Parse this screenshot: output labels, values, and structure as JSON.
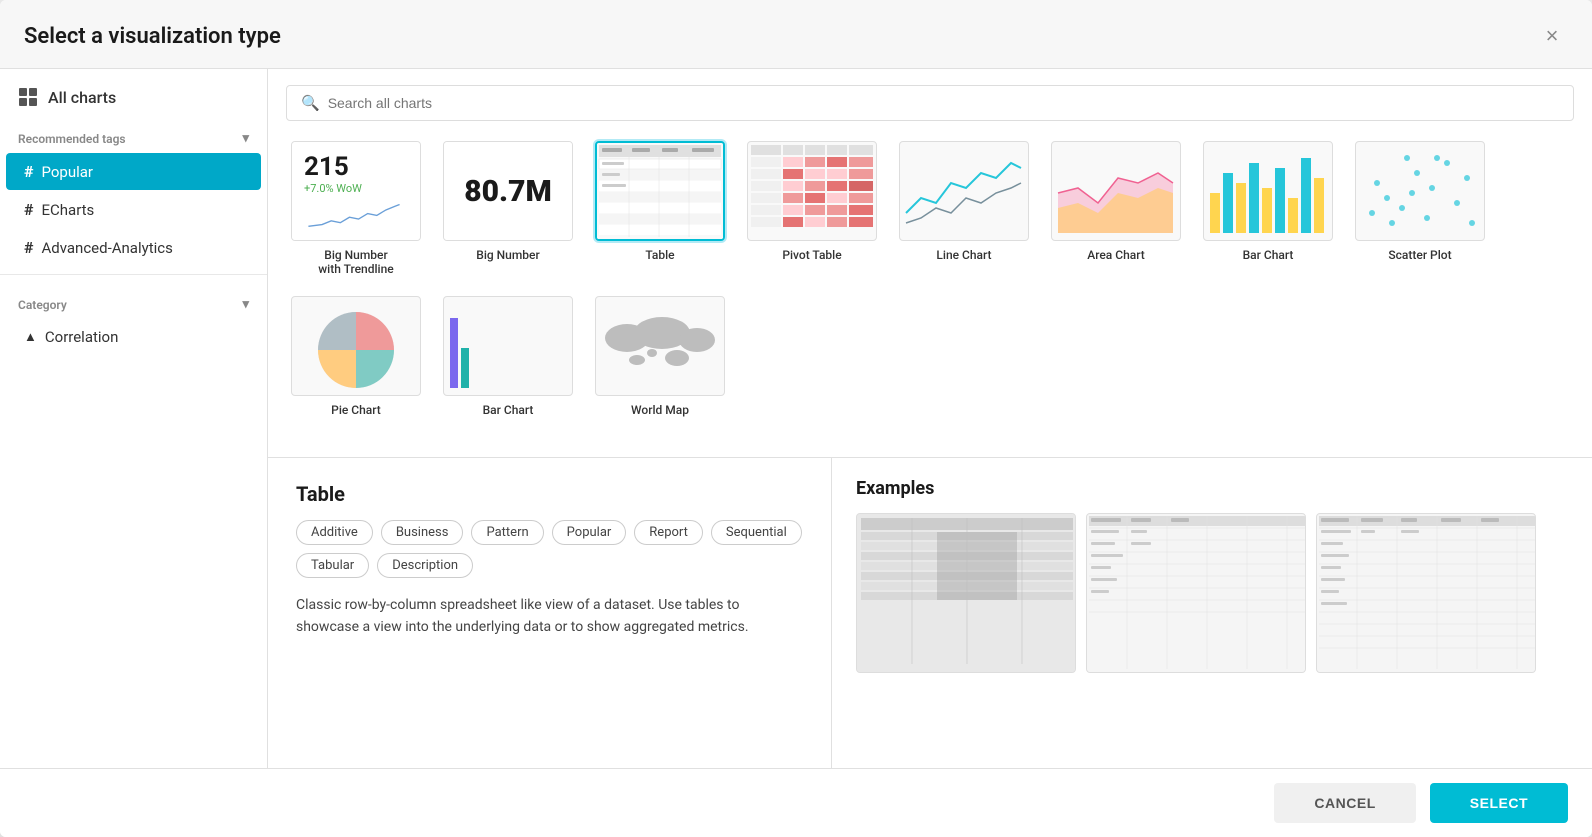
{
  "dialog": {
    "title": "Select a visualization type",
    "close_label": "×"
  },
  "sidebar": {
    "all_charts_label": "All charts",
    "recommended_tags_label": "Recommended tags",
    "category_label": "Category",
    "tags": [
      {
        "id": "popular",
        "label": "Popular",
        "active": true
      },
      {
        "id": "echarts",
        "label": "ECharts",
        "active": false
      },
      {
        "id": "advanced-analytics",
        "label": "Advanced-Analytics",
        "active": false
      }
    ],
    "categories": [
      {
        "id": "correlation",
        "label": "Correlation",
        "active": false
      }
    ]
  },
  "search": {
    "placeholder": "Search all charts"
  },
  "charts": [
    {
      "id": "big-number-trendline",
      "label": "Big Number\nwith Trendline",
      "selected": false
    },
    {
      "id": "big-number",
      "label": "Big Number",
      "selected": false
    },
    {
      "id": "table",
      "label": "Table",
      "selected": true
    },
    {
      "id": "pivot-table",
      "label": "Pivot Table",
      "selected": false
    },
    {
      "id": "line-chart",
      "label": "Line Chart",
      "selected": false
    },
    {
      "id": "area-chart",
      "label": "Area Chart",
      "selected": false
    },
    {
      "id": "bar-chart",
      "label": "Bar Chart",
      "selected": false
    },
    {
      "id": "scatter-plot",
      "label": "Scatter Plot",
      "selected": false
    },
    {
      "id": "pie-chart",
      "label": "Pie Chart",
      "selected": false
    },
    {
      "id": "bar-chart-2",
      "label": "Bar Chart",
      "selected": false
    },
    {
      "id": "world-map",
      "label": "World Map",
      "selected": false
    }
  ],
  "detail": {
    "title": "Table",
    "tags": [
      "Additive",
      "Business",
      "Pattern",
      "Popular",
      "Report",
      "Sequential",
      "Tabular",
      "Description"
    ],
    "description": "Classic row-by-column spreadsheet like view of a dataset. Use tables to showcase a view into the underlying data or to show aggregated metrics."
  },
  "examples": {
    "title": "Examples"
  },
  "footer": {
    "cancel_label": "CANCEL",
    "select_label": "SELECT"
  }
}
